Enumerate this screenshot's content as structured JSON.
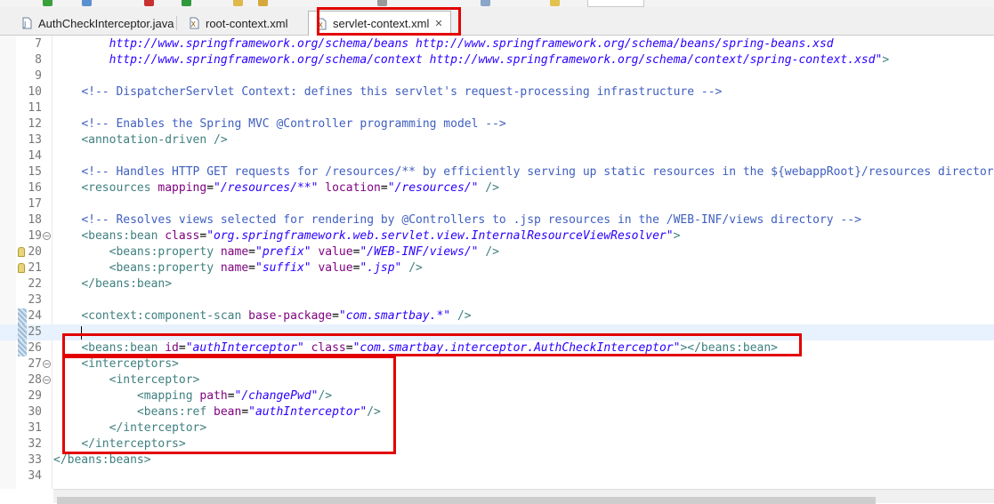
{
  "colors": {
    "highlight": "#e30000",
    "tag": "#3f7f7f",
    "attribute": "#7f007f",
    "value": "#2a00ff",
    "comment": "#3f5fbf"
  },
  "tabs": [
    {
      "label": "AuthCheckInterceptor.java",
      "icon": "java-file-icon",
      "active": false
    },
    {
      "label": "root-context.xml",
      "icon": "xml-file-icon",
      "active": false
    },
    {
      "label": "servlet-context.xml",
      "icon": "xml-file-icon",
      "active": true,
      "close": "✕"
    }
  ],
  "lines": [
    {
      "n": "7",
      "parts": [
        [
          "t",
          "        "
        ],
        [
          "val",
          "http://www.springframework.org/schema/beans http://www.springframework.org/schema/beans/spring-beans.xsd"
        ]
      ]
    },
    {
      "n": "8",
      "parts": [
        [
          "t",
          "        "
        ],
        [
          "val",
          "http://www.springframework.org/schema/context http://www.springframework.org/schema/context/spring-context.xsd\""
        ],
        [
          "tag",
          ">"
        ]
      ]
    },
    {
      "n": "9",
      "parts": []
    },
    {
      "n": "10",
      "parts": [
        [
          "t",
          "    "
        ],
        [
          "com",
          "<!-- DispatcherServlet Context: defines this servlet's request-processing infrastructure -->"
        ]
      ]
    },
    {
      "n": "11",
      "parts": []
    },
    {
      "n": "12",
      "parts": [
        [
          "t",
          "    "
        ],
        [
          "com",
          "<!-- Enables the Spring MVC @Controller programming model -->"
        ]
      ]
    },
    {
      "n": "13",
      "parts": [
        [
          "t",
          "    "
        ],
        [
          "tag",
          "<annotation-driven />"
        ]
      ]
    },
    {
      "n": "14",
      "parts": []
    },
    {
      "n": "15",
      "parts": [
        [
          "t",
          "    "
        ],
        [
          "com",
          "<!-- Handles HTTP GET requests for /resources/** by efficiently serving up static resources in the ${webappRoot}/resources directory -->"
        ]
      ]
    },
    {
      "n": "16",
      "parts": [
        [
          "t",
          "    "
        ],
        [
          "tag",
          "<resources "
        ],
        [
          "attr",
          "mapping"
        ],
        [
          "t",
          "="
        ],
        [
          "val",
          "\"/resources/**\""
        ],
        [
          "t",
          " "
        ],
        [
          "attr",
          "location"
        ],
        [
          "t",
          "="
        ],
        [
          "val",
          "\"/resources/\""
        ],
        [
          "t",
          " "
        ],
        [
          "tag",
          "/>"
        ]
      ]
    },
    {
      "n": "17",
      "parts": []
    },
    {
      "n": "18",
      "parts": [
        [
          "t",
          "    "
        ],
        [
          "com",
          "<!-- Resolves views selected for rendering by @Controllers to .jsp resources in the /WEB-INF/views directory -->"
        ]
      ]
    },
    {
      "n": "19",
      "fold": "−",
      "parts": [
        [
          "t",
          "    "
        ],
        [
          "tag",
          "<beans:bean "
        ],
        [
          "attr",
          "class"
        ],
        [
          "t",
          "="
        ],
        [
          "val",
          "\"org.springframework.web.servlet.view.InternalResourceViewResolver\""
        ],
        [
          "tag",
          ">"
        ]
      ]
    },
    {
      "n": "20",
      "marker": true,
      "parts": [
        [
          "t",
          "        "
        ],
        [
          "tag",
          "<beans:property "
        ],
        [
          "attr",
          "name"
        ],
        [
          "t",
          "="
        ],
        [
          "val",
          "\"prefix\""
        ],
        [
          "t",
          " "
        ],
        [
          "attr",
          "value"
        ],
        [
          "t",
          "="
        ],
        [
          "val",
          "\"/WEB-INF/views/\""
        ],
        [
          "t",
          " "
        ],
        [
          "tag",
          "/>"
        ]
      ]
    },
    {
      "n": "21",
      "marker": true,
      "parts": [
        [
          "t",
          "        "
        ],
        [
          "tag",
          "<beans:property "
        ],
        [
          "attr",
          "name"
        ],
        [
          "t",
          "="
        ],
        [
          "val",
          "\"suffix\""
        ],
        [
          "t",
          " "
        ],
        [
          "attr",
          "value"
        ],
        [
          "t",
          "="
        ],
        [
          "val",
          "\".jsp\""
        ],
        [
          "t",
          " "
        ],
        [
          "tag",
          "/>"
        ]
      ]
    },
    {
      "n": "22",
      "parts": [
        [
          "t",
          "    "
        ],
        [
          "tag",
          "</beans:bean>"
        ]
      ]
    },
    {
      "n": "23",
      "parts": []
    },
    {
      "n": "24",
      "change": true,
      "parts": [
        [
          "t",
          "    "
        ],
        [
          "tag",
          "<context:component-scan "
        ],
        [
          "attr",
          "base-package"
        ],
        [
          "t",
          "="
        ],
        [
          "val",
          "\"com.smartbay.*\""
        ],
        [
          "t",
          " "
        ],
        [
          "tag",
          "/>"
        ]
      ]
    },
    {
      "n": "25",
      "change": true,
      "current": true,
      "caret": true,
      "parts": []
    },
    {
      "n": "26",
      "change": true,
      "parts": [
        [
          "t",
          "    "
        ],
        [
          "tag",
          "<beans:bean "
        ],
        [
          "attr",
          "id"
        ],
        [
          "t",
          "="
        ],
        [
          "val",
          "\"authInterceptor\""
        ],
        [
          "t",
          " "
        ],
        [
          "attr",
          "class"
        ],
        [
          "t",
          "="
        ],
        [
          "val",
          "\"com.smartbay.interceptor.AuthCheckInterceptor\""
        ],
        [
          "tag",
          "></beans:bean>"
        ]
      ]
    },
    {
      "n": "27",
      "fold": "−",
      "parts": [
        [
          "t",
          "    "
        ],
        [
          "tag",
          "<interceptors>"
        ]
      ]
    },
    {
      "n": "28",
      "fold": "−",
      "parts": [
        [
          "t",
          "        "
        ],
        [
          "tag",
          "<interceptor>"
        ]
      ]
    },
    {
      "n": "29",
      "parts": [
        [
          "t",
          "            "
        ],
        [
          "tag",
          "<mapping "
        ],
        [
          "attr",
          "path"
        ],
        [
          "t",
          "="
        ],
        [
          "val",
          "\"/changePwd\""
        ],
        [
          "tag",
          "/>"
        ]
      ]
    },
    {
      "n": "30",
      "parts": [
        [
          "t",
          "            "
        ],
        [
          "tag",
          "<beans:ref "
        ],
        [
          "attr",
          "bean"
        ],
        [
          "t",
          "="
        ],
        [
          "val",
          "\"authInterceptor\""
        ],
        [
          "tag",
          "/>"
        ]
      ]
    },
    {
      "n": "31",
      "parts": [
        [
          "t",
          "        "
        ],
        [
          "tag",
          "</interceptor>"
        ]
      ]
    },
    {
      "n": "32",
      "parts": [
        [
          "t",
          "    "
        ],
        [
          "tag",
          "</interceptors>"
        ]
      ]
    },
    {
      "n": "33",
      "parts": [
        [
          "tag",
          "</beans:beans>"
        ]
      ]
    },
    {
      "n": "34",
      "parts": []
    }
  ]
}
